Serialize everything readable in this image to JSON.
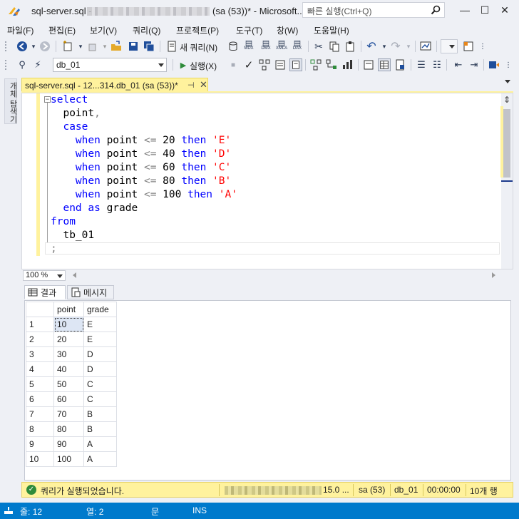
{
  "window": {
    "title_left": "sql-server.sql - ",
    "title_right": "(sa (53))* - Microsoft...",
    "quick_launch_placeholder": "빠른 실행(Ctrl+Q)",
    "minimize": "—",
    "maximize": "☐",
    "close": "✕"
  },
  "menu": [
    "파일(F)",
    "편집(E)",
    "보기(V)",
    "쿼리(Q)",
    "프로젝트(P)",
    "도구(T)",
    "창(W)",
    "도움말(H)"
  ],
  "toolbar": {
    "new_query_label": "새 쿼리(N)",
    "database": "db_01",
    "execute_label": "실행(X)",
    "mdx": "MDX",
    "dmx": "DMX",
    "xmla": "XMLA",
    "dax": "DAX"
  },
  "left_tab": {
    "label": "개체 탐색기"
  },
  "document_tab": {
    "label": "sql-server.sql - 12...314.db_01 (sa (53))*",
    "pin": "⊣",
    "close": "✕"
  },
  "editor": {
    "collapse_symbol": "−",
    "lines": [
      [
        {
          "t": "select",
          "c": "kw"
        }
      ],
      [
        {
          "t": "  point",
          "c": "bk"
        },
        {
          "t": ",",
          "c": "gr"
        }
      ],
      [
        {
          "t": "  case",
          "c": "kw"
        }
      ],
      [
        {
          "t": "    when ",
          "c": "kw"
        },
        {
          "t": "point ",
          "c": "bk"
        },
        {
          "t": "<= ",
          "c": "gr"
        },
        {
          "t": "20 ",
          "c": "bk"
        },
        {
          "t": "then ",
          "c": "kw"
        },
        {
          "t": "'E'",
          "c": "st"
        }
      ],
      [
        {
          "t": "    when ",
          "c": "kw"
        },
        {
          "t": "point ",
          "c": "bk"
        },
        {
          "t": "<= ",
          "c": "gr"
        },
        {
          "t": "40 ",
          "c": "bk"
        },
        {
          "t": "then ",
          "c": "kw"
        },
        {
          "t": "'D'",
          "c": "st"
        }
      ],
      [
        {
          "t": "    when ",
          "c": "kw"
        },
        {
          "t": "point ",
          "c": "bk"
        },
        {
          "t": "<= ",
          "c": "gr"
        },
        {
          "t": "60 ",
          "c": "bk"
        },
        {
          "t": "then ",
          "c": "kw"
        },
        {
          "t": "'C'",
          "c": "st"
        }
      ],
      [
        {
          "t": "    when ",
          "c": "kw"
        },
        {
          "t": "point ",
          "c": "bk"
        },
        {
          "t": "<= ",
          "c": "gr"
        },
        {
          "t": "80 ",
          "c": "bk"
        },
        {
          "t": "then ",
          "c": "kw"
        },
        {
          "t": "'B'",
          "c": "st"
        }
      ],
      [
        {
          "t": "    when ",
          "c": "kw"
        },
        {
          "t": "point ",
          "c": "bk"
        },
        {
          "t": "<= ",
          "c": "gr"
        },
        {
          "t": "100 ",
          "c": "bk"
        },
        {
          "t": "then ",
          "c": "kw"
        },
        {
          "t": "'A'",
          "c": "st"
        }
      ],
      [
        {
          "t": "  end as ",
          "c": "kw"
        },
        {
          "t": "grade",
          "c": "bk"
        }
      ],
      [
        {
          "t": "from",
          "c": "kw"
        }
      ],
      [
        {
          "t": "  tb_01",
          "c": "bk"
        }
      ],
      [
        {
          "t": ";",
          "c": "gr"
        }
      ]
    ],
    "zoom": "100 %"
  },
  "results": {
    "tabs": [
      "결과",
      "메시지"
    ],
    "columns": [
      "point",
      "grade"
    ],
    "rows": [
      [
        "1",
        "10",
        "E"
      ],
      [
        "2",
        "20",
        "E"
      ],
      [
        "3",
        "30",
        "D"
      ],
      [
        "4",
        "40",
        "D"
      ],
      [
        "5",
        "50",
        "C"
      ],
      [
        "6",
        "60",
        "C"
      ],
      [
        "7",
        "70",
        "B"
      ],
      [
        "8",
        "80",
        "B"
      ],
      [
        "9",
        "90",
        "A"
      ],
      [
        "10",
        "100",
        "A"
      ]
    ]
  },
  "query_status": {
    "message": "쿼리가 실행되었습니다.",
    "server_version": "15.0 ...",
    "user": "sa (53)",
    "database": "db_01",
    "elapsed": "00:00:00",
    "row_count": "10개 행"
  },
  "status_bar": {
    "line": "줄: 12",
    "column": "열: 2",
    "char": "문",
    "mode": "INS"
  },
  "colors": {
    "accent_blue": "#007acc",
    "tab_yellow": "#fff29d",
    "keyword_blue": "#0000ff",
    "string_red": "#ff0000",
    "operator_gray": "#808080"
  }
}
